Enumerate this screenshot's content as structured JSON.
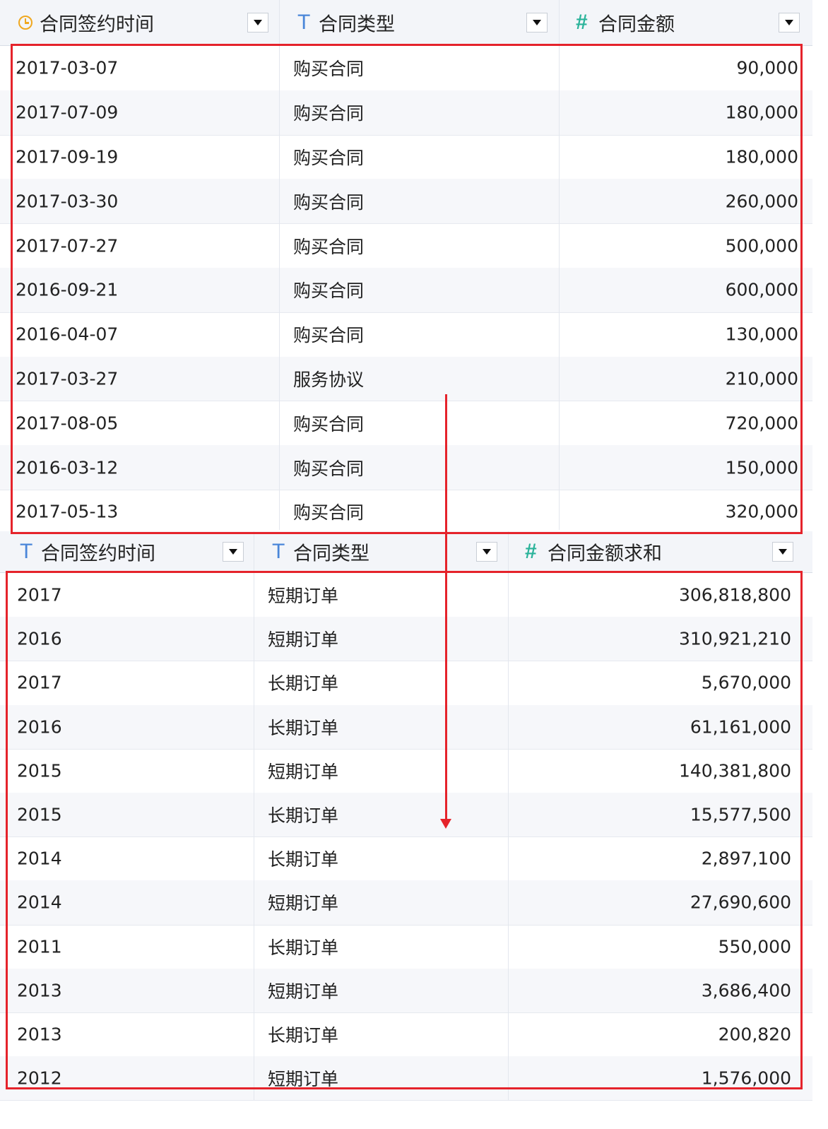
{
  "table1": {
    "headers": [
      {
        "label": "合同签约时间",
        "icon": "clock-icon"
      },
      {
        "label": "合同类型",
        "icon": "text-type-icon",
        "glyph": "T"
      },
      {
        "label": "合同金额",
        "icon": "number-type-icon",
        "glyph": "#"
      }
    ],
    "rows": [
      [
        "2017-03-07",
        "购买合同",
        "90,000"
      ],
      [
        "2017-07-09",
        "购买合同",
        "180,000"
      ],
      [
        "2017-09-19",
        "购买合同",
        "180,000"
      ],
      [
        "2017-03-30",
        "购买合同",
        "260,000"
      ],
      [
        "2017-07-27",
        "购买合同",
        "500,000"
      ],
      [
        "2016-09-21",
        "购买合同",
        "600,000"
      ],
      [
        "2016-04-07",
        "购买合同",
        "130,000"
      ],
      [
        "2017-03-27",
        "服务协议",
        "210,000"
      ],
      [
        "2017-08-05",
        "购买合同",
        "720,000"
      ],
      [
        "2016-03-12",
        "购买合同",
        "150,000"
      ],
      [
        "2017-05-13",
        "购买合同",
        "320,000"
      ]
    ]
  },
  "table2": {
    "headers": [
      {
        "label": "合同签约时间",
        "icon": "text-type-icon",
        "glyph": "T"
      },
      {
        "label": "合同类型",
        "icon": "text-type-icon",
        "glyph": "T"
      },
      {
        "label": "合同金额求和",
        "icon": "number-type-icon",
        "glyph": "#"
      }
    ],
    "rows": [
      [
        "2017",
        "短期订单",
        "306,818,800"
      ],
      [
        "2016",
        "短期订单",
        "310,921,210"
      ],
      [
        "2017",
        "长期订单",
        "5,670,000"
      ],
      [
        "2016",
        "长期订单",
        "61,161,000"
      ],
      [
        "2015",
        "短期订单",
        "140,381,800"
      ],
      [
        "2015",
        "长期订单",
        "15,577,500"
      ],
      [
        "2014",
        "长期订单",
        "2,897,100"
      ],
      [
        "2014",
        "短期订单",
        "27,690,600"
      ],
      [
        "2011",
        "长期订单",
        "550,000"
      ],
      [
        "2013",
        "短期订单",
        "3,686,400"
      ],
      [
        "2013",
        "长期订单",
        "200,820"
      ],
      [
        "2012",
        "短期订单",
        "1,576,000"
      ]
    ]
  },
  "colors": {
    "highlight": "#e5232b",
    "text_icon": "#4a86d9",
    "number_icon": "#2ab39a",
    "time_icon": "#f0a820"
  }
}
